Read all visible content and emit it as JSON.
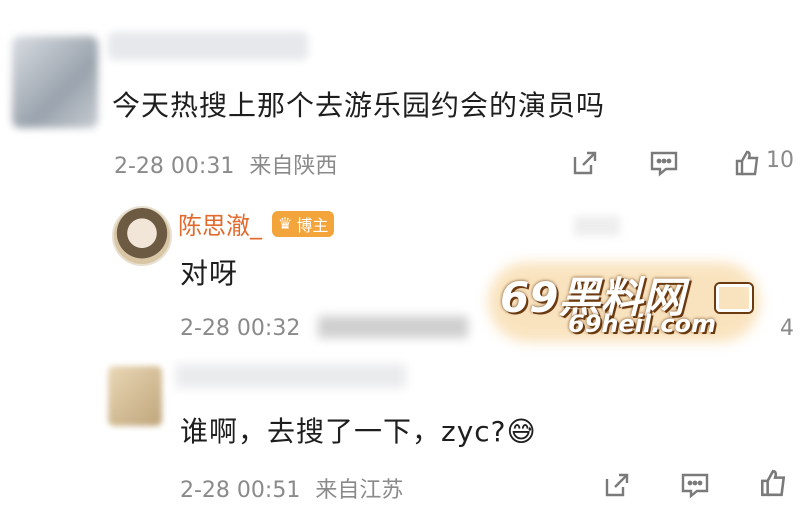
{
  "comment_1": {
    "text": "今天热搜上那个去游乐园约会的演员吗",
    "time": "2-28 00:31",
    "location": "来自陕西",
    "like_count": "10"
  },
  "reply": {
    "username": "陈思澈_",
    "badge": "博主",
    "text": "对呀",
    "time": "2-28 00:32",
    "like_count": "4"
  },
  "comment_2": {
    "text": "谁啊，去搜了一下，zyc?",
    "emoji": "😅",
    "time": "2-28 00:51",
    "location": "来自江苏"
  },
  "watermark": {
    "line1": "69黑料网",
    "line2": "69heil.com"
  },
  "colors": {
    "username": "#e26a2c",
    "badge": "#f3a43a",
    "meta": "#8a8a8a"
  },
  "icons": [
    "share-icon",
    "comment-icon",
    "like-icon"
  ]
}
